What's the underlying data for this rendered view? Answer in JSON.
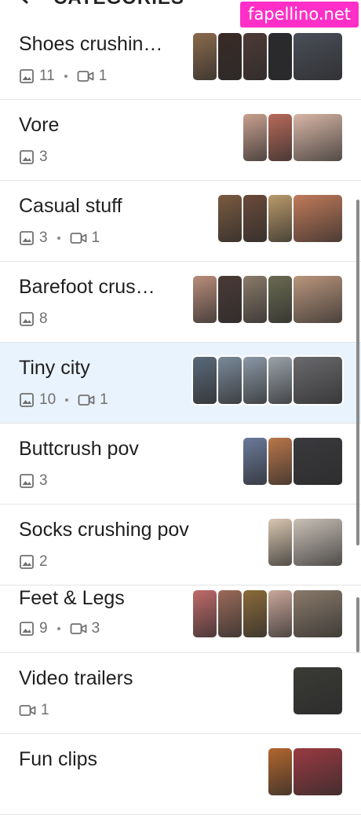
{
  "header": {
    "title": "CATEGORIES",
    "back_icon": "back-arrow-icon"
  },
  "watermark": {
    "text": "fapellino.net"
  },
  "categories": [
    {
      "title": "Shoes crushin…",
      "photos": "11",
      "videos": "1",
      "thumb_colors": [
        "#8a6a4c",
        "#3a2a26",
        "#4e3a36",
        "#2a2a2e",
        "#4a4e58"
      ]
    },
    {
      "title": "Vore",
      "photos": "3",
      "videos": "",
      "thumb_colors": [
        "#c9a08e",
        "#b86a5a",
        "#d8b6a6"
      ]
    },
    {
      "title": "Casual stuff",
      "photos": "3",
      "videos": "1",
      "thumb_colors": [
        "#7a5a40",
        "#6a4a3a",
        "#b99a6a",
        "#c07a5a"
      ]
    },
    {
      "title": "Barefoot crus…",
      "photos": "8",
      "videos": "",
      "thumb_colors": [
        "#b98d7a",
        "#4a3a36",
        "#8a7a6a",
        "#6a6a52",
        "#b9957c"
      ]
    },
    {
      "title": "Tiny city",
      "photos": "10",
      "videos": "1",
      "thumb_colors": [
        "#5a6a7a",
        "#7a8a9a",
        "#8a98a6",
        "#9aa2aa",
        "#6a6a6e"
      ]
    },
    {
      "title": "Buttcrush pov",
      "photos": "3",
      "videos": "",
      "thumb_colors": [
        "#6a7a9a",
        "#b9764a",
        "#3a3a3e"
      ]
    },
    {
      "title": "Socks crushing pov",
      "photos": "2",
      "videos": "",
      "thumb_colors": [
        "#d8c6b0",
        "#c9c0b6"
      ]
    },
    {
      "title": "Feet & Legs",
      "photos": "9",
      "videos": "3",
      "thumb_colors": [
        "#c06a6a",
        "#9a6a5a",
        "#8a6a3a",
        "#c9a69a",
        "#8a7a6a"
      ]
    },
    {
      "title": "Video trailers",
      "photos": "",
      "videos": "1",
      "thumb_colors": [
        "#3a3a36"
      ]
    },
    {
      "title": "Fun clips",
      "photos": "",
      "videos": "",
      "thumb_colors": [
        "#b2662e",
        "#9a3a42"
      ]
    }
  ],
  "colors": {
    "highlight_row": "#e9f3fd",
    "divider": "#e4e4e4",
    "meta_text": "#6f6f6f",
    "watermark_bg": "#ff2fc7"
  }
}
